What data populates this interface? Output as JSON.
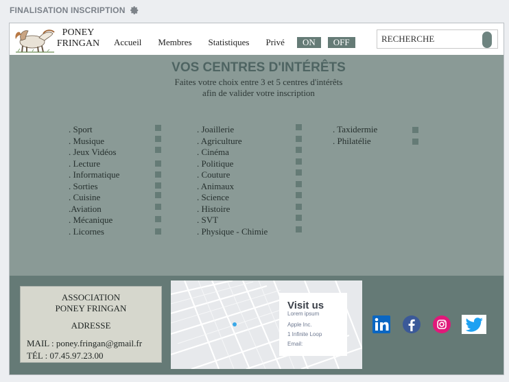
{
  "topbar": {
    "title": "FINALISATION INSCRIPTION",
    "icon": "gear-icon"
  },
  "header": {
    "brand_line1": "PONEY",
    "brand_line2": "FRINGAN",
    "nav": [
      "Accueil",
      "Membres",
      "Statistiques",
      "Privé"
    ],
    "toggle_on": "ON",
    "toggle_off": "OFF",
    "search_value": "RECHERCHE"
  },
  "interests": {
    "title": "VOS CENTRES D'INTÉRÊTS",
    "subtitle_line1": "Faites votre choix entre 3 et 5 centres d'intérêts",
    "subtitle_line2": "afin de valider votre inscription",
    "col1": [
      ". Sport",
      ". Musique",
      ". Jeux Vidéos",
      ". Lecture",
      ". Informatique",
      ". Sorties",
      ". Cuisine",
      ".Aviation",
      ". Mécanique",
      ". Licornes"
    ],
    "col2": [
      ". Joaillerie",
      ". Agriculture",
      ". Cinéma",
      ". Politique",
      ". Couture",
      ". Animaux",
      ". Science",
      ". Histoire",
      ". SVT",
      ". Physique - Chimie"
    ],
    "col3": [
      ". Taxidermie",
      ". Philatélie"
    ]
  },
  "footer": {
    "assoc_line1": "ASSOCIATION",
    "assoc_line2": "PONEY FRINGAN",
    "address_label": "ADRESSE",
    "mail": "MAIL : poney.fringan@gmail.fr",
    "tel": "TÉL : 07.45.97.23.00",
    "map_card": {
      "heading": "Visit us",
      "line1": "Lorem ipsum",
      "line2": "Apple Inc.",
      "line3": "1 Infinite Loop",
      "line4": "Email:"
    },
    "social_icons": [
      "linkedin-icon",
      "facebook-icon",
      "instagram-icon",
      "twitter-icon"
    ]
  },
  "colors": {
    "body_bg": "#8a9a96",
    "accent": "#657b76",
    "footer_bg": "#657a76",
    "title": "#4e6462"
  }
}
